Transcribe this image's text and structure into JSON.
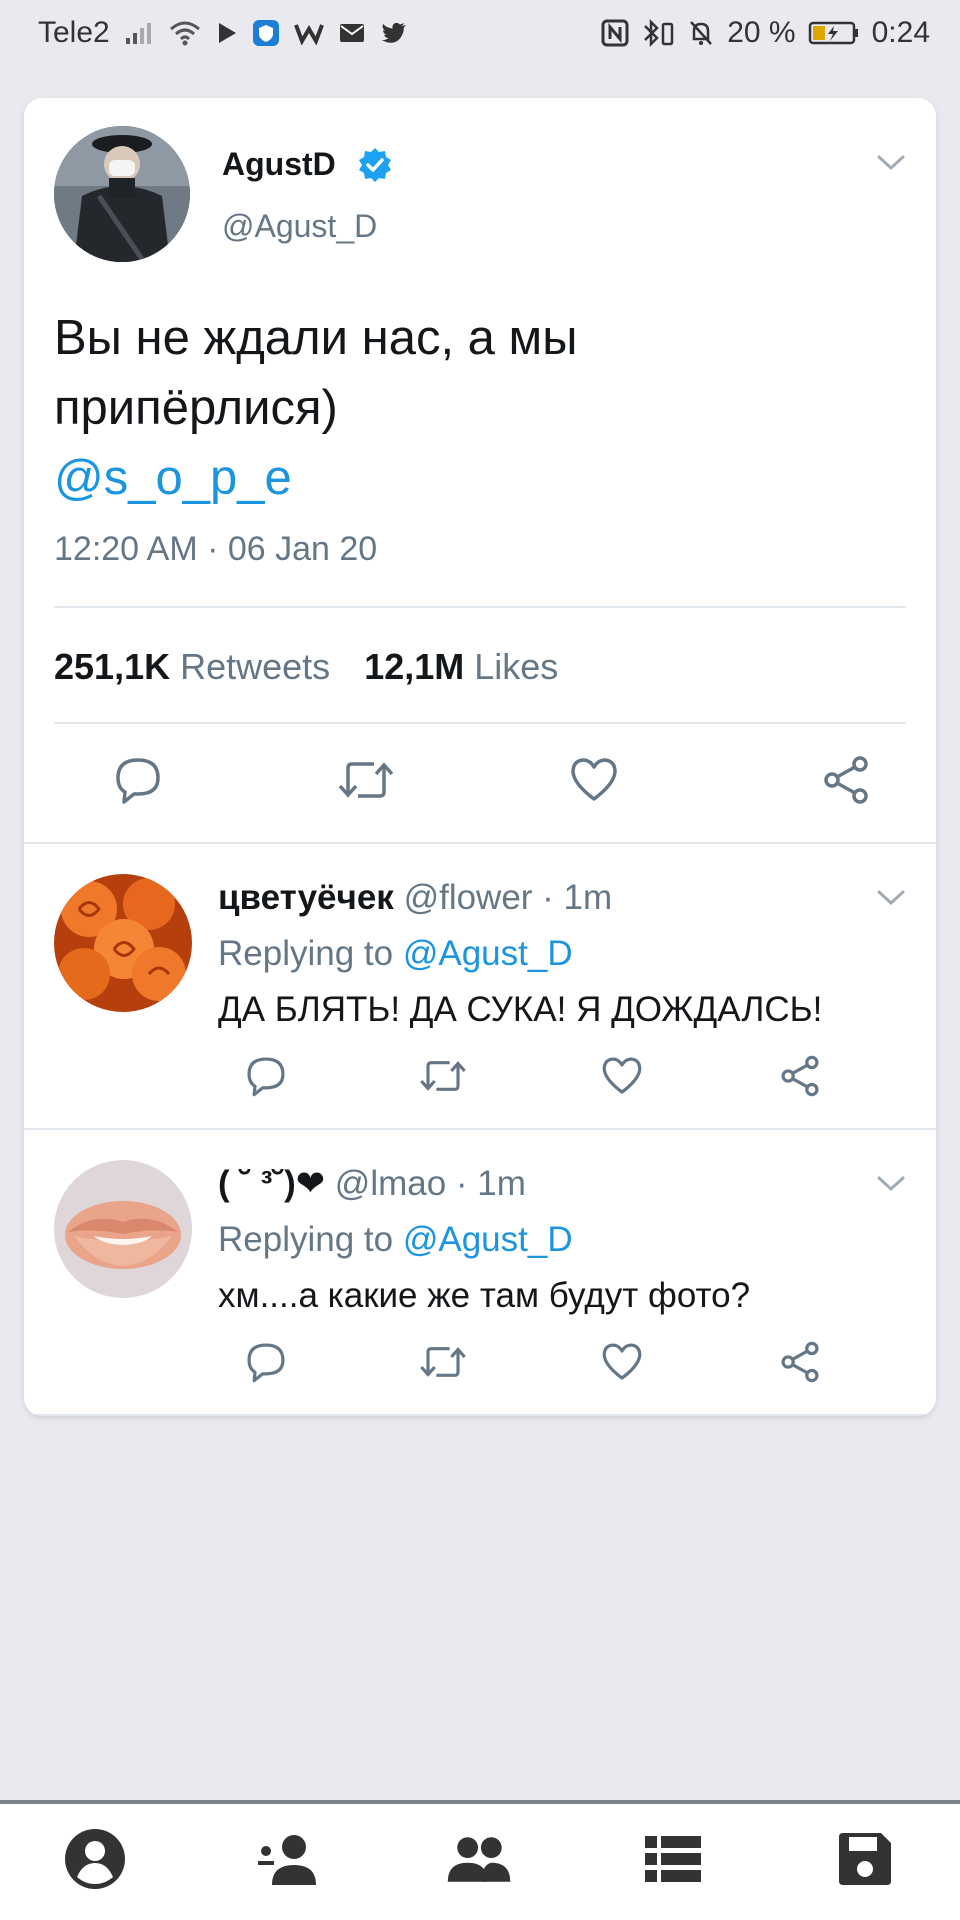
{
  "status_bar": {
    "carrier": "Tele2",
    "battery_percent": "20 %",
    "time": "0:24"
  },
  "tweet": {
    "author_name": "AgustD",
    "author_handle": "@Agust_D",
    "text_line1": "Вы не ждали нас, а мы",
    "text_line2": "припёрлися)",
    "mention": "@s_o_p_e",
    "timestamp": "12:20 AM · 06 Jan 20",
    "retweets_count": "251,1K",
    "retweets_label": "Retweets",
    "likes_count": "12,1M",
    "likes_label": "Likes"
  },
  "replies": [
    {
      "name": "цветуёчек",
      "meta": "@flower · 1m",
      "replying_prefix": "Replying to",
      "replying_to": "@Agust_D",
      "text": "ДА БЛЯТЬ! ДА СУКА! Я ДОЖДАЛСЬ!"
    },
    {
      "name": "( ˘ ³˘)❤",
      "meta": "@lmao · 1m",
      "replying_prefix": "Replying to",
      "replying_to": "@Agust_D",
      "text": "хм....а какие же там будут фото?"
    }
  ],
  "colors": {
    "link_blue": "#1b95e0",
    "secondary_text": "#657786",
    "background": "#e9e9ef"
  },
  "icons": {
    "nav": [
      "profile-icon",
      "add-user-icon",
      "group-icon",
      "list-icon",
      "save-icon"
    ],
    "actions": [
      "reply-icon",
      "retweet-icon",
      "like-icon",
      "share-icon"
    ]
  }
}
